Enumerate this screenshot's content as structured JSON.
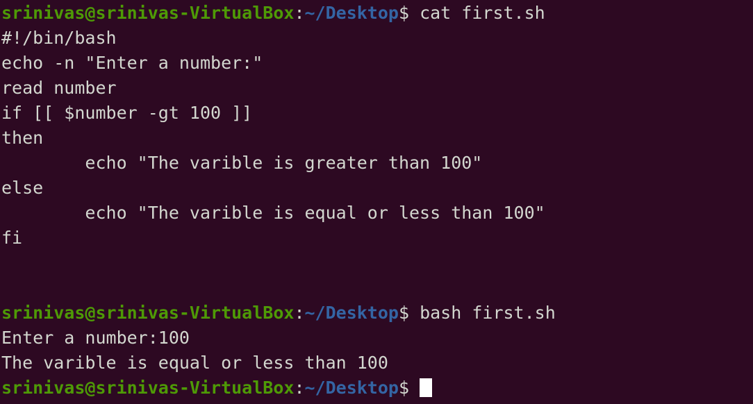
{
  "terminal": {
    "app": "gnome-terminal",
    "colors": {
      "background": "#2d0922",
      "foreground": "#d3d7cf",
      "prompt_user_host": "#4e9a06",
      "prompt_path": "#3465a4",
      "cursor": "#ffffff"
    },
    "prompt": {
      "user_host": "srinivas@srinivas-VirtualBox",
      "colon": ":",
      "path": "~/Desktop",
      "sigil": "$",
      "space": " "
    },
    "lines": [
      {
        "type": "prompt",
        "command": " cat first.sh"
      },
      {
        "type": "output",
        "text": "#!/bin/bash"
      },
      {
        "type": "output",
        "text": "echo -n \"Enter a number:\""
      },
      {
        "type": "output",
        "text": "read number"
      },
      {
        "type": "output",
        "text": "if [[ $number -gt 100 ]]"
      },
      {
        "type": "output",
        "text": "then"
      },
      {
        "type": "output",
        "text": "        echo \"The varible is greater than 100\""
      },
      {
        "type": "output",
        "text": "else"
      },
      {
        "type": "output",
        "text": "        echo \"The varible is equal or less than 100\""
      },
      {
        "type": "output",
        "text": "fi"
      },
      {
        "type": "output",
        "text": ""
      },
      {
        "type": "output",
        "text": ""
      },
      {
        "type": "prompt",
        "command": " bash first.sh"
      },
      {
        "type": "output",
        "text": "Enter a number:100"
      },
      {
        "type": "output",
        "text": "The varible is equal or less than 100"
      },
      {
        "type": "prompt",
        "command": " ",
        "cursor": true
      }
    ]
  }
}
